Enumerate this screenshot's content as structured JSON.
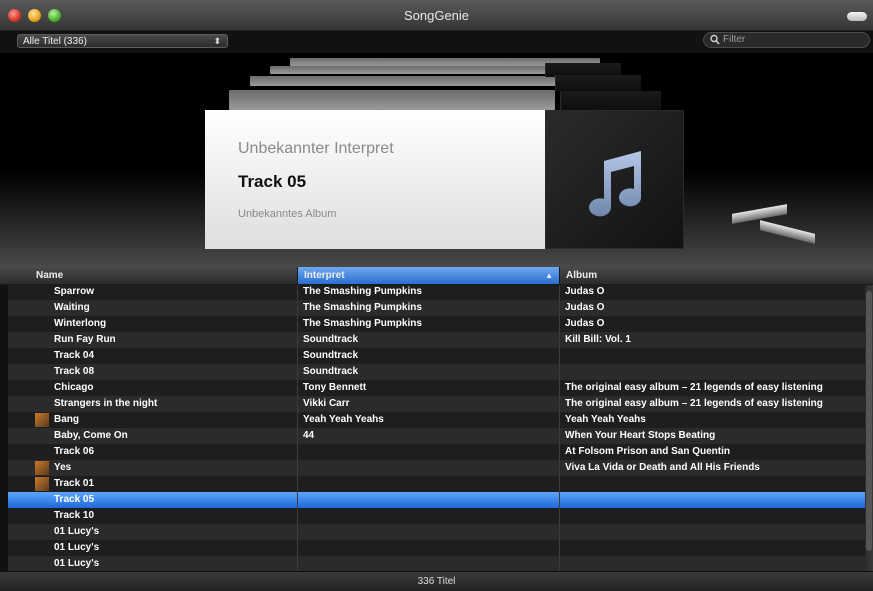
{
  "window": {
    "title": "SongGenie"
  },
  "toolbar": {
    "source_label": "Alle Titel (336)",
    "source_arrows": "⬍",
    "filter_placeholder": "Filter"
  },
  "coverflow": {
    "artist": "Unbekannter Interpret",
    "track": "Track 05",
    "album": "Unbekanntes Album",
    "art_icon": "music-note-icon"
  },
  "table": {
    "columns": {
      "name": "Name",
      "interpret": "Interpret",
      "album": "Album"
    },
    "sort_column": "Interpret",
    "sort_indicator": "▲",
    "rows": [
      {
        "name": "Sparrow",
        "interpret": "The Smashing Pumpkins",
        "album": "Judas O"
      },
      {
        "name": "Waiting",
        "interpret": "The Smashing Pumpkins",
        "album": "Judas O"
      },
      {
        "name": "Winterlong",
        "interpret": "The Smashing Pumpkins",
        "album": "Judas O"
      },
      {
        "name": "Run Fay Run",
        "interpret": "Soundtrack",
        "album": "Kill Bill: Vol. 1"
      },
      {
        "name": "Track 04",
        "interpret": "Soundtrack",
        "album": ""
      },
      {
        "name": "Track 08",
        "interpret": "Soundtrack",
        "album": ""
      },
      {
        "name": "Chicago",
        "interpret": "Tony Bennett",
        "album": "The original easy album – 21 legends of easy listening"
      },
      {
        "name": "Strangers in the night",
        "interpret": "Vikki Carr",
        "album": "The original easy album – 21 legends of easy listening"
      },
      {
        "name": "Bang",
        "interpret": "Yeah Yeah Yeahs",
        "album": "Yeah Yeah Yeahs",
        "icon": "album-art-icon"
      },
      {
        "name": "Baby, Come On",
        "interpret": "44",
        "album": "When Your Heart Stops Beating"
      },
      {
        "name": "Track 06",
        "interpret": "",
        "album": "At Folsom Prison and San Quentin"
      },
      {
        "name": "Yes",
        "interpret": "",
        "album": "Viva La Vida or Death and All His Friends",
        "icon": "album-art-icon"
      },
      {
        "name": "Track 01",
        "interpret": "",
        "album": "",
        "icon": "album-art-icon"
      },
      {
        "name": "Track 05",
        "interpret": "",
        "album": "",
        "selected": true
      },
      {
        "name": "Track 10",
        "interpret": "",
        "album": ""
      },
      {
        "name": "01 Lucy's",
        "interpret": "",
        "album": ""
      },
      {
        "name": "01 Lucy's",
        "interpret": "",
        "album": ""
      },
      {
        "name": "01 Lucy's",
        "interpret": "",
        "album": ""
      }
    ]
  },
  "status": {
    "count_text": "336 Titel"
  },
  "colors": {
    "selection": "#2a78e4",
    "background": "#111111"
  }
}
